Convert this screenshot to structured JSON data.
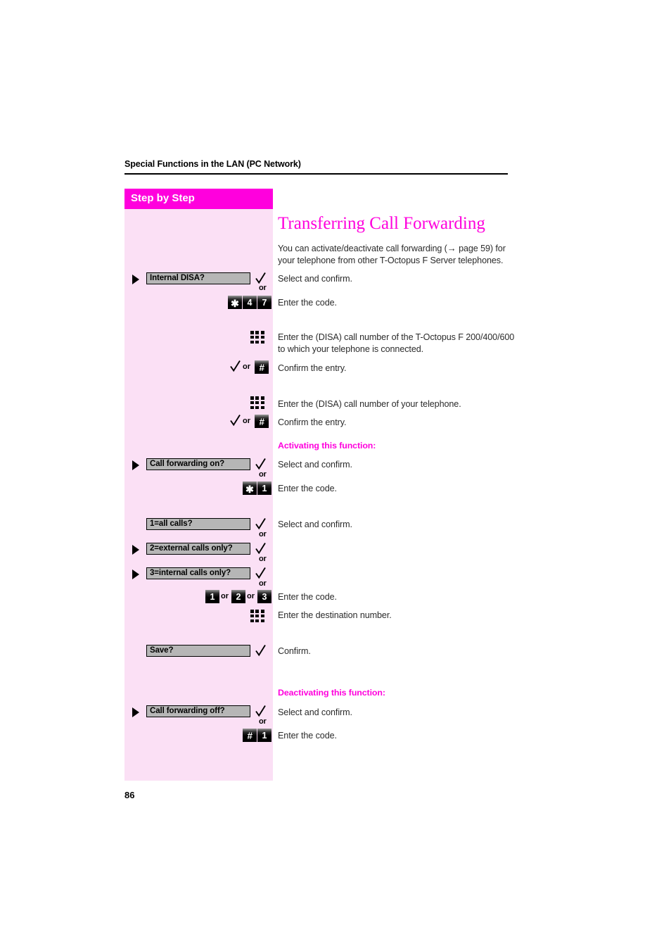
{
  "document": {
    "running_head": "Special Functions in the LAN (PC Network)",
    "page_number": "86"
  },
  "sidebar": {
    "header_label": "Step by Step",
    "background_color": "#fbe0f5",
    "header_color": "#ff00dd"
  },
  "content": {
    "title": "Transferring Call Forwarding",
    "intro": {
      "before_arrow": "You can activate/deactivate call forwarding (",
      "arrow": "→",
      "after_arrow": " page 59) for your telephone from other T-Octopus F Server telephones."
    },
    "headings": {
      "activating": "Activating this function:",
      "deactivating": "Deactivating this function:"
    },
    "descriptions": {
      "select_and_confirm_1": "Select and confirm.",
      "enter_the_code_1": "Enter the code.",
      "enter_disa_server": "Enter the (DISA) call number of the T-Octopus F 200/400/600 to which your telephone is connected.",
      "confirm_entry_1": "Confirm the entry.",
      "enter_disa_own": "Enter the (DISA) call number of your telephone.",
      "confirm_entry_2": "Confirm the entry.",
      "select_and_confirm_2": "Select and confirm.",
      "enter_the_code_2": "Enter the code.",
      "select_and_confirm_3": "Select and confirm.",
      "enter_the_code_3": "Enter the code.",
      "enter_destination": "Enter the destination number.",
      "confirm": "Confirm.",
      "select_and_confirm_4": "Select and confirm.",
      "enter_the_code_4": "Enter the code."
    }
  },
  "steps": {
    "internal_disa": "Internal DISA?",
    "call_forwarding_on": "Call forwarding on?",
    "option_all_calls": "1=all calls?",
    "option_external_only": "2=external calls only?",
    "option_internal_only": "3=internal calls only?",
    "save": "Save?",
    "call_forwarding_off": "Call forwarding off?"
  },
  "keys": {
    "star": "✱",
    "hash": "#",
    "d1": "1",
    "d2": "2",
    "d3": "3",
    "d4": "4",
    "d7": "7"
  },
  "labels": {
    "or": "or"
  }
}
